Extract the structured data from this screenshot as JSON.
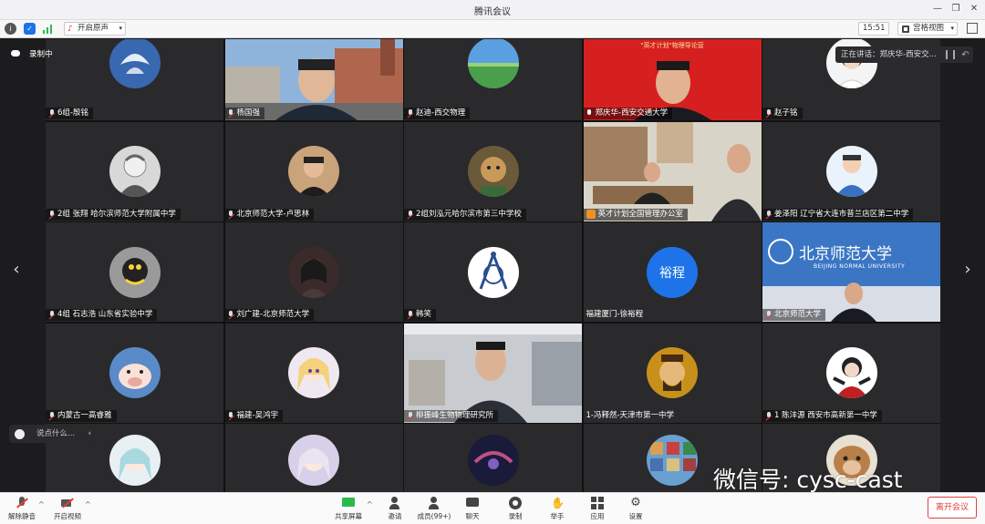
{
  "window": {
    "title": "腾讯会议"
  },
  "toolbar": {
    "audio_label": "开启原声",
    "time": "15:51",
    "view_label": "宫格视图"
  },
  "overlay": {
    "recording": "录制中",
    "speaking": "正在讲话：郑庆华-西安交...",
    "chat_placeholder": "说点什么...",
    "watermark": "微信号: cysc-cast"
  },
  "participants": [
    {
      "name": "6组-殷铭",
      "mic": "muted"
    },
    {
      "name": "杨国强",
      "mic": "muted"
    },
    {
      "name": "赵迪-西交物理",
      "mic": "muted"
    },
    {
      "name": "郑庆华-西安交通大学",
      "mic": "on"
    },
    {
      "name": "赵子铭",
      "mic": "muted"
    },
    {
      "name": "2组 张翔 哈尔滨师范大学附属中学",
      "mic": "muted"
    },
    {
      "name": "北京师范大学-卢思林",
      "mic": "muted"
    },
    {
      "name": "2组刘泓元哈尔滨市第三中学校",
      "mic": "muted"
    },
    {
      "name": "英才计划全国管理办公室",
      "mic": "muted"
    },
    {
      "name": "姜泽阳 辽宁省大连市普兰店区第二中学",
      "mic": "muted"
    },
    {
      "name": "4组 石志浩 山东省实验中学",
      "mic": "muted"
    },
    {
      "name": "刘广建-北京师范大学",
      "mic": "muted"
    },
    {
      "name": "韩笑",
      "mic": "muted"
    },
    {
      "name": "福建厦门-徐裕程",
      "mic": "none",
      "avatar_text": "裕程"
    },
    {
      "name": "北京师范大学",
      "mic": "muted"
    },
    {
      "name": "内蒙古一高睿雅",
      "mic": "muted"
    },
    {
      "name": "福建-吴鸿宇",
      "mic": "muted"
    },
    {
      "name": "柳振峰生物物理研究所",
      "mic": "muted"
    },
    {
      "name": "1-冯释然-天津市第一中学",
      "mic": "none"
    },
    {
      "name": "1 陈沣源 西安市高新第一中学",
      "mic": "muted"
    },
    {
      "name": "",
      "mic": "none"
    },
    {
      "name": "",
      "mic": "none"
    },
    {
      "name": "",
      "mic": "none"
    },
    {
      "name": "",
      "mic": "none"
    },
    {
      "name": "",
      "mic": "none"
    }
  ],
  "tile_captions": {
    "banner": "\"英才计划\"物理导论营",
    "bnu_logo": "北京师范大学",
    "bnu_en": "BEIJING NORMAL UNIVERSITY"
  },
  "bottombar": {
    "unmute": "解除静音",
    "video": "开启视频",
    "share": "共享屏幕",
    "invite": "邀请",
    "members": "成员(99+)",
    "chat": "聊天",
    "record": "录制",
    "raise_hand": "举手",
    "apps": "应用",
    "settings": "设置",
    "leave": "离开会议"
  },
  "colors": {
    "accent_blue": "#1e73e8",
    "leave_red": "#e04040",
    "banner_red": "#d62020"
  }
}
